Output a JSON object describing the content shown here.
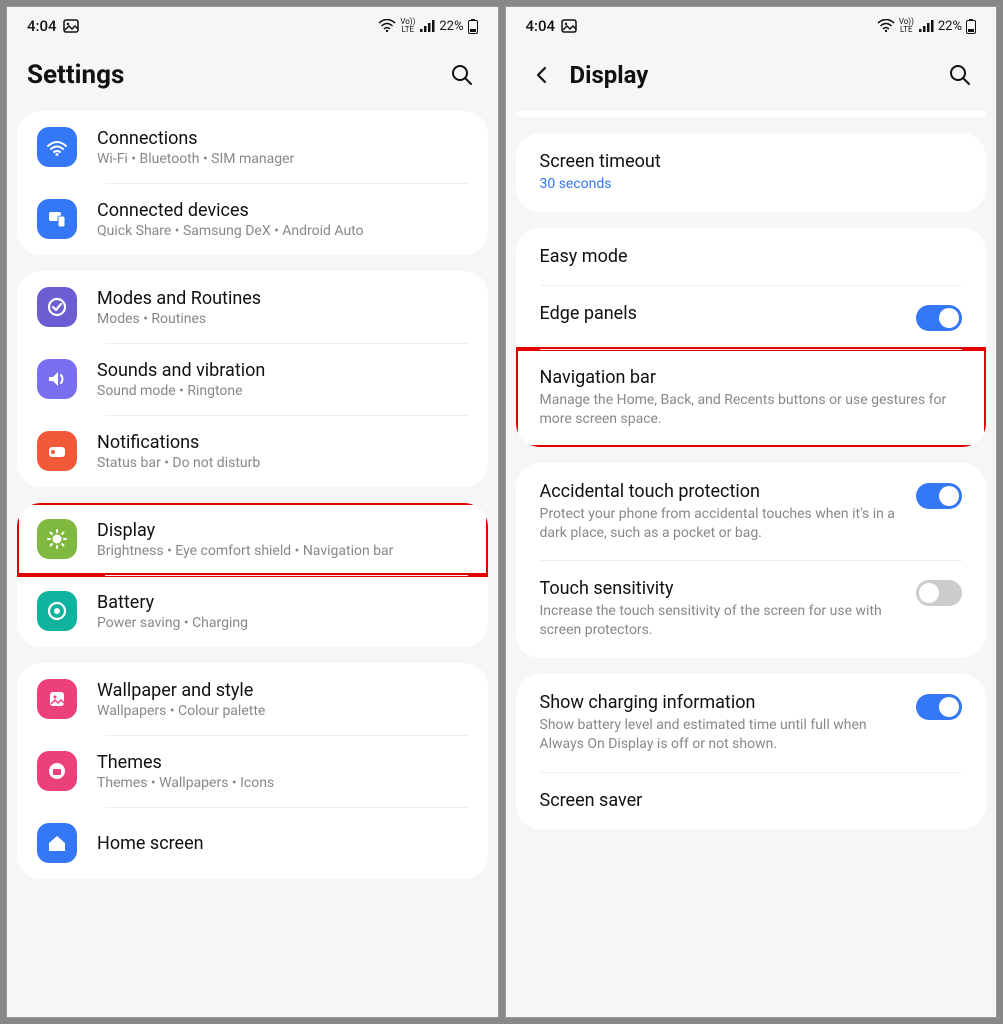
{
  "status": {
    "time": "4:04",
    "battery": "22%",
    "volte": "Vo))\nLTE"
  },
  "left": {
    "title": "Settings",
    "groups": [
      {
        "items": [
          {
            "key": "connections",
            "title": "Connections",
            "subtitle": "Wi-Fi • Bluetooth • SIM manager",
            "icon": "wifi",
            "color": "#3478f6"
          },
          {
            "key": "connected-devices",
            "title": "Connected devices",
            "subtitle": "Quick Share • Samsung DeX • Android Auto",
            "icon": "devices",
            "color": "#3478f6"
          }
        ]
      },
      {
        "items": [
          {
            "key": "modes",
            "title": "Modes and Routines",
            "subtitle": "Modes • Routines",
            "icon": "routines",
            "color": "#6c5dd3"
          },
          {
            "key": "sounds",
            "title": "Sounds and vibration",
            "subtitle": "Sound mode • Ringtone",
            "icon": "sound",
            "color": "#7a6ff0"
          },
          {
            "key": "notifications",
            "title": "Notifications",
            "subtitle": "Status bar • Do not disturb",
            "icon": "notifications",
            "color": "#f05a38"
          }
        ]
      },
      {
        "highlight": true,
        "items": [
          {
            "key": "display",
            "title": "Display",
            "subtitle": "Brightness • Eye comfort shield • Navigation bar",
            "icon": "display",
            "color": "#7fb93f",
            "highlight": true
          },
          {
            "key": "battery",
            "title": "Battery",
            "subtitle": "Power saving • Charging",
            "icon": "battery",
            "color": "#0fb39e"
          }
        ]
      },
      {
        "items": [
          {
            "key": "wallpaper",
            "title": "Wallpaper and style",
            "subtitle": "Wallpapers • Colour palette",
            "icon": "wallpaper",
            "color": "#ec407a"
          },
          {
            "key": "themes",
            "title": "Themes",
            "subtitle": "Themes • Wallpapers • Icons",
            "icon": "themes",
            "color": "#ec407a"
          },
          {
            "key": "homescreen",
            "title": "Home screen",
            "subtitle": "",
            "icon": "home",
            "color": "#3478f6"
          }
        ]
      }
    ]
  },
  "right": {
    "title": "Display",
    "groups": [
      {
        "slim": true
      },
      {
        "items": [
          {
            "key": "screen-timeout",
            "title": "Screen timeout",
            "subtitle": "30 seconds",
            "blue": true
          }
        ]
      },
      {
        "items": [
          {
            "key": "easy-mode",
            "title": "Easy mode"
          },
          {
            "key": "edge-panels",
            "title": "Edge panels",
            "toggle": "on"
          },
          {
            "key": "navigation-bar",
            "title": "Navigation bar",
            "subtitle": "Manage the Home, Back, and Recents buttons or use gestures for more screen space.",
            "highlight": true
          }
        ]
      },
      {
        "items": [
          {
            "key": "accidental-touch",
            "title": "Accidental touch protection",
            "subtitle": "Protect your phone from accidental touches when it's in a dark place, such as a pocket or bag.",
            "toggle": "on"
          },
          {
            "key": "touch-sensitivity",
            "title": "Touch sensitivity",
            "subtitle": "Increase the touch sensitivity of the screen for use with screen protectors.",
            "toggle": "off"
          }
        ]
      },
      {
        "items": [
          {
            "key": "charging-info",
            "title": "Show charging information",
            "subtitle": "Show battery level and estimated time until full when Always On Display is off or not shown.",
            "toggle": "on"
          },
          {
            "key": "screen-saver",
            "title": "Screen saver"
          }
        ]
      }
    ]
  }
}
